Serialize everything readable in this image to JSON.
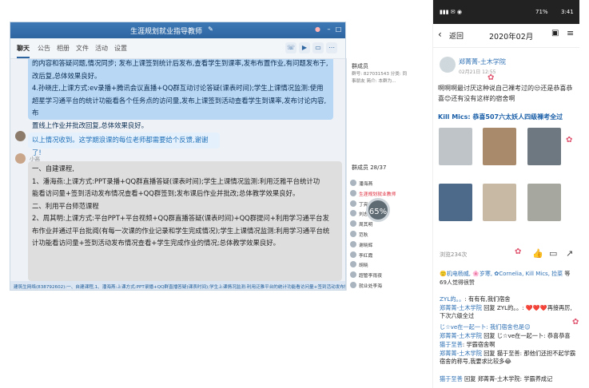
{
  "qq_window": {
    "title": "生涯规划就业指导教师",
    "tabs": [
      "聊天",
      "公告",
      "相册",
      "文件",
      "活动",
      "设置"
    ],
    "messages": [
      {
        "type": "blue",
        "lines": [
          "的内容和答疑问题,情况同步; 发布上课签到统计后发布,查看学生到课率,发布布置作业,有问题发布于,",
          "改后复,总体效果良好。",
          "4.孙晓庄,上课方式:ev录播+腾讯会议直播+QQ群互动讨论答疑(课表时间);学生上课情况监测:使用",
          "超星学习通平台的统计功能看各个任务点的访问量,发布上课签到活动查看学生到课率,发布讨论内容,布",
          "置线上作业并批改回复,总体效果良好。"
        ]
      },
      {
        "type": "light",
        "lines": [
          "以上情况收到。这学期浪课的每位老师都需要给个反馈,谢谢了!"
        ]
      },
      {
        "sender": "小高",
        "type": "gray",
        "lines": [
          "一、自建课程,",
          "1、潘海燕:上课方式:PPT录播+QQ群直播答疑(课表时间);学生上课情况监测:利用泛雅平台统计功",
          "能看访问量+签到活动发布情况查看+QQ群签到;发布课后作业并批改;总体教学效果良好。",
          "二、利用平台师范课程",
          "2、周其明:上课方式:平台PPT+平台视频+QQ群直播答疑(课表时间)+QQ群提问+利用学习通平台发",
          "布作业并通过平台批阅(有每一次课的作业记录和学生完成情况);学生上课情况监测:利用学习通平台统",
          "计功能看访问量+签到活动发布情况查看+学生完成作业的情况;总体教学效果良好。"
        ]
      }
    ],
    "side_panel": {
      "header": "群成员",
      "info": "群号: 827031543 分类: 同事朋友 简介: 本群为...",
      "members_header": "群成员 28/37",
      "members": [
        "潘海燕",
        "生涯规划就业教师",
        "丁亮",
        "刘志",
        "周其明",
        "范秋",
        "谢晓辉",
        "李红霞",
        "胡晓",
        "超管李雨夜",
        "就业处李海",
        "杨程"
      ]
    },
    "progress_badge": "65%",
    "quote_bar": "建筑生网络(838792602):一、自建课程,1、潘海燕:上课方式:PPT录播+QQ群直播答疑(课表时间);学生上课情况监测:利用泛雅平台的统计功能看访问量+签到活动发布情况"
  },
  "phone": {
    "status_time": "3:41",
    "status_battery": "71%",
    "nav": {
      "back": "返回",
      "title": "2020年02月"
    },
    "post": {
      "author": "郑菁菁-土木学院",
      "time": "02月21日 12:55",
      "text_lines": [
        "啊啊啊最讨厌这种说自己裸考过的😒还是恭喜恭",
        "喜😊还有没有这样的宿舍啊"
      ],
      "headline": "Kill Mics: 恭喜507六太妖人四级裸考全过",
      "views": "浏览234次"
    },
    "likes_line": [
      "🙂机电杨威,",
      "🌸岁寒,",
      "✿Cornelia,",
      "Kill Mics,",
      "捡菜",
      "等69人觉得很赞"
    ],
    "comments": [
      {
        "name": "ZYL的。。",
        "text": ": 有有有,我们宿舍"
      },
      {
        "name": "郑菁菁-土木学院",
        "text": " 回复 ZYL的。。: ❤️❤️❤️再接再厉,下次六级全过"
      },
      {
        "name": "じ☆ve在一起一卜",
        "text": ": 我们宿舍也是😉"
      },
      {
        "name": "郑菁菁-土木学院",
        "text": " 回复 じ☆ve在一起一卜: 恭喜恭喜"
      },
      {
        "name": "猫于至善",
        "text": ": 学霸宿舍啊"
      },
      {
        "name": "郑菁菁-土木学院",
        "text": " 回复 猫于至善: 那他们还担不起学霸宿舍的称号,我要求比较多😂"
      },
      {
        "name": "猫于至善",
        "text": " 回复 郑菁菁-土木学院: 学霸养成记"
      }
    ]
  }
}
